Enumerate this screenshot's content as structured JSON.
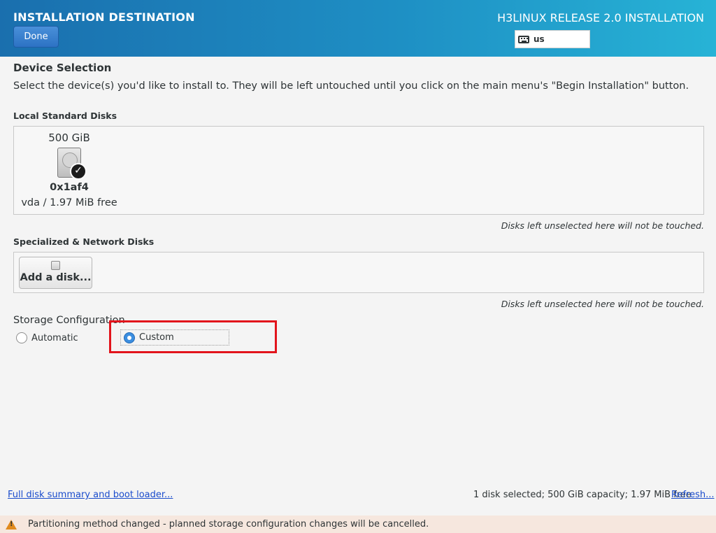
{
  "header": {
    "title": "INSTALLATION DESTINATION",
    "done_label": "Done",
    "product": "H3LINUX RELEASE 2.0 INSTALLATION",
    "keyboard_layout": "us"
  },
  "device_selection": {
    "title": "Device Selection",
    "description": "Select the device(s) you'd like to install to.  They will be left untouched until you click on the main menu's \"Begin Installation\" button."
  },
  "local_disks": {
    "title": "Local Standard Disks",
    "disks": [
      {
        "size": "500 GiB",
        "name": "0x1af4",
        "free": "vda  /  1.97 MiB free",
        "selected": true
      }
    ],
    "note": "Disks left unselected here will not be touched."
  },
  "network_disks": {
    "title": "Specialized & Network Disks",
    "add_label": "Add a disk...",
    "note": "Disks left unselected here will not be touched."
  },
  "storage": {
    "title": "Storage Configuration",
    "options": [
      {
        "label": "Automatic",
        "selected": false
      },
      {
        "label": "Custom",
        "selected": true
      }
    ]
  },
  "footer": {
    "summary_link": "Full disk summary and boot loader...",
    "summary": "1 disk selected; 500 GiB capacity; 1.97 MiB free",
    "refresh_link": "Refresh..."
  },
  "warning": {
    "text": "Partitioning method changed - planned storage configuration changes will be cancelled."
  },
  "colors": {
    "header_start": "#1a6fae",
    "header_end": "#27b3d6",
    "highlight": "#e2141c",
    "warning_bg": "#f6e7de"
  }
}
